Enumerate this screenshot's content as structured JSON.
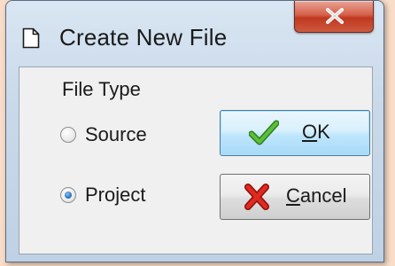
{
  "dialog": {
    "title": "Create New File",
    "close_glyph": "x"
  },
  "file_type": {
    "label": "File Type",
    "options": [
      {
        "label": "Source",
        "selected": false
      },
      {
        "label": "Project",
        "selected": true
      }
    ]
  },
  "buttons": {
    "ok": {
      "label_mnemonic": "O",
      "label_rest": "K",
      "icon": "checkmark-icon",
      "color": "#3d9a2a"
    },
    "cancel": {
      "label_mnemonic": "C",
      "label_rest": "ancel",
      "icon": "x-icon",
      "color": "#d11f1f"
    }
  },
  "colors": {
    "background": "#f9ddc8",
    "close_button": "#c0381f",
    "default_button_border": "#3c7fb1"
  }
}
